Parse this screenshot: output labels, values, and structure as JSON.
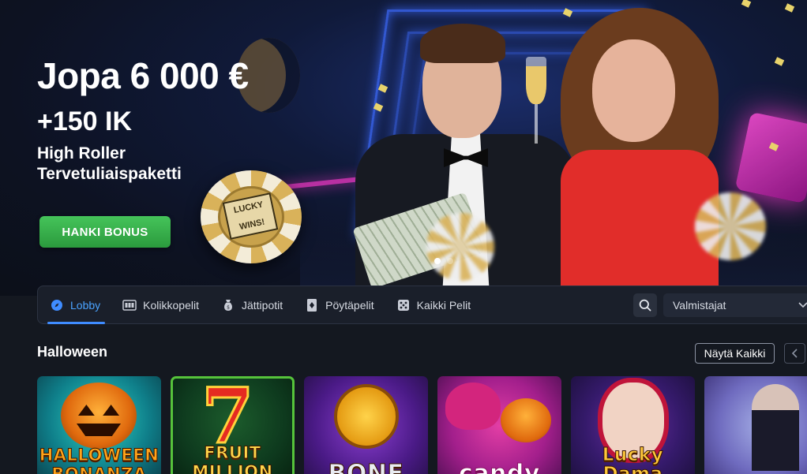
{
  "hero": {
    "title": "Jopa 6 000 €",
    "subtitle": "+150 IK",
    "description": "High Roller Tervetuliaispaketti",
    "cta_label": "HANKI BONUS",
    "chip_text": "LUCKY WINS!",
    "slides": [
      {
        "active": true
      },
      {
        "active": false
      }
    ]
  },
  "nav": {
    "items": [
      {
        "label": "Lobby",
        "icon": "compass-icon",
        "active": true
      },
      {
        "label": "Kolikkopelit",
        "icon": "slot-machine-icon",
        "active": false
      },
      {
        "label": "Jättipotit",
        "icon": "money-bag-icon",
        "active": false
      },
      {
        "label": "Pöytäpelit",
        "icon": "playing-card-icon",
        "active": false
      },
      {
        "label": "Kaikki Pelit",
        "icon": "dice-icon",
        "active": false
      }
    ],
    "search_icon": "search-icon",
    "provider_placeholder": "Valmistajat"
  },
  "section": {
    "title": "Halloween",
    "show_all_label": "Näytä Kaikki"
  },
  "games": [
    {
      "name": "HALLOWEEN BONANZA",
      "label_color": "#ffa31a"
    },
    {
      "name": "FRUIT MILLION",
      "label_color": "#ffd54a"
    },
    {
      "name": "BONE",
      "label_color": "#e9ecf2"
    },
    {
      "name": "candy",
      "label_color": "#ffffff"
    },
    {
      "name": "Lucky Dama",
      "label_color": "#ffc83a"
    },
    {
      "name": "",
      "label_color": "#ffffff"
    }
  ],
  "colors": {
    "accent": "#3f8cff",
    "cta": "#3bb54e",
    "background": "#141820"
  }
}
